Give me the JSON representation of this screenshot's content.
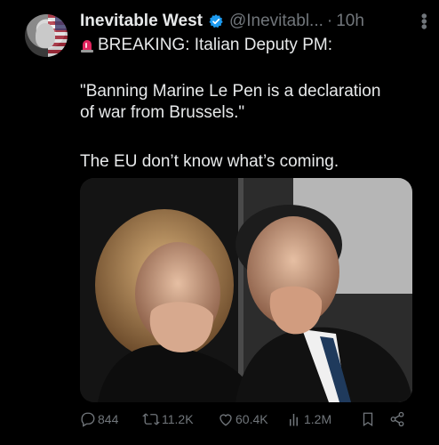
{
  "post": {
    "author_name": "Inevitable West",
    "handle": "@Inevitabl...",
    "separator": "·",
    "time": "10h",
    "breaking_line": "BREAKING: Italian Deputy PM:",
    "quote_line1": "\"Banning Marine Le Pen is a declaration",
    "quote_line2": "of war from Brussels.\"",
    "closing_line": "The EU don’t know what’s coming."
  },
  "actions": {
    "replies": "844",
    "reposts": "11.2K",
    "likes": "60.4K",
    "views": "1.2M"
  },
  "icons": {
    "verified": "verified-badge-icon",
    "siren": "siren-emoji-icon",
    "more": "more-options-icon",
    "reply": "reply-icon",
    "repost": "repost-icon",
    "like": "heart-icon",
    "views": "bar-chart-icon",
    "bookmark": "bookmark-icon",
    "share": "share-icon"
  },
  "colors": {
    "background": "#000000",
    "text": "#e7e9ea",
    "muted": "#71767b",
    "verified": "#1d9bf0",
    "siren": "#e0245e"
  }
}
